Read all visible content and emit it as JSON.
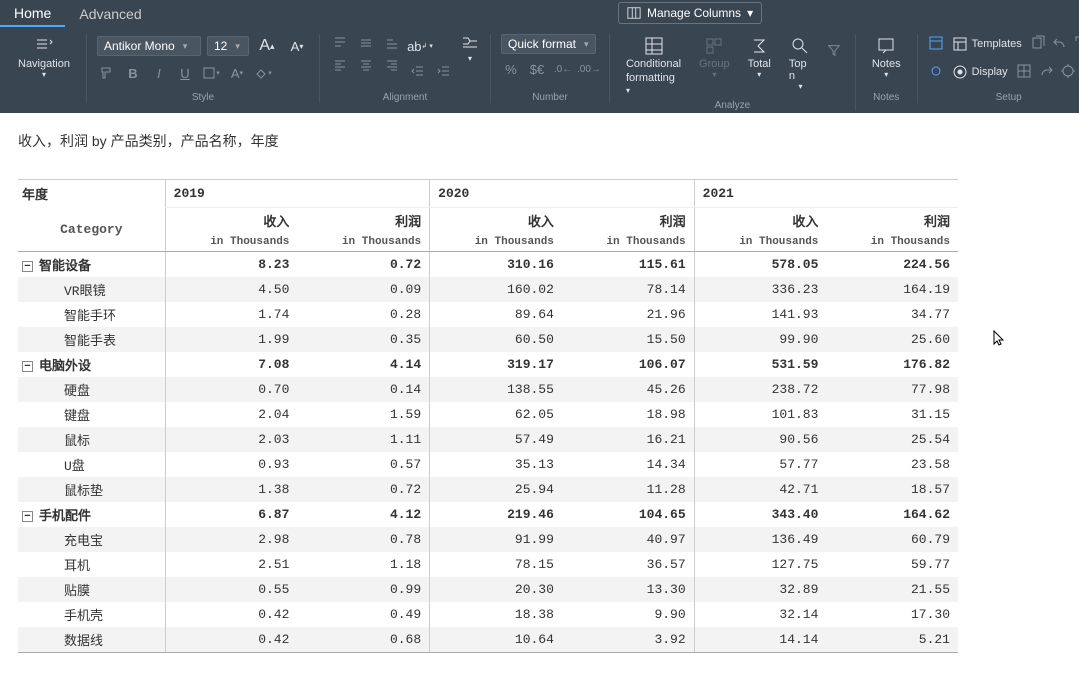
{
  "tabs": {
    "home": "Home",
    "advanced": "Advanced"
  },
  "manage_columns": "Manage Columns",
  "font_family": "Antikor Mono",
  "font_size": "12",
  "quick_format": "Quick format",
  "groups": {
    "style": "Style",
    "alignment": "Alignment",
    "number": "Number",
    "analyze": "Analyze",
    "notes": "Notes",
    "setup": "Setup"
  },
  "buttons": {
    "navigation": "Navigation",
    "conditional": "Conditional",
    "formatting": "formatting",
    "group": "Group",
    "total": "Total",
    "topn": "Top n",
    "notes": "Notes",
    "templates": "Templates",
    "display": "Display"
  },
  "title": "收入，利润 by 产品类别，产品名称，年度",
  "pivot": {
    "year_label": "年度",
    "category_label": "Category",
    "years": [
      "2019",
      "2020",
      "2021"
    ],
    "metrics": [
      "收入",
      "利润"
    ],
    "unit": "in Thousands",
    "rows": [
      {
        "type": "cat",
        "label": "智能设备",
        "v": [
          "8.23",
          "0.72",
          "310.16",
          "115.61",
          "578.05",
          "224.56"
        ]
      },
      {
        "type": "sub",
        "label": "VR眼镜",
        "v": [
          "4.50",
          "0.09",
          "160.02",
          "78.14",
          "336.23",
          "164.19"
        ]
      },
      {
        "type": "sub",
        "label": "智能手环",
        "v": [
          "1.74",
          "0.28",
          "89.64",
          "21.96",
          "141.93",
          "34.77"
        ]
      },
      {
        "type": "sub",
        "label": "智能手表",
        "v": [
          "1.99",
          "0.35",
          "60.50",
          "15.50",
          "99.90",
          "25.60"
        ]
      },
      {
        "type": "cat",
        "label": "电脑外设",
        "v": [
          "7.08",
          "4.14",
          "319.17",
          "106.07",
          "531.59",
          "176.82"
        ]
      },
      {
        "type": "sub",
        "label": "硬盘",
        "v": [
          "0.70",
          "0.14",
          "138.55",
          "45.26",
          "238.72",
          "77.98"
        ]
      },
      {
        "type": "sub",
        "label": "键盘",
        "v": [
          "2.04",
          "1.59",
          "62.05",
          "18.98",
          "101.83",
          "31.15"
        ]
      },
      {
        "type": "sub",
        "label": "鼠标",
        "v": [
          "2.03",
          "1.11",
          "57.49",
          "16.21",
          "90.56",
          "25.54"
        ]
      },
      {
        "type": "sub",
        "label": "U盘",
        "v": [
          "0.93",
          "0.57",
          "35.13",
          "14.34",
          "57.77",
          "23.58"
        ]
      },
      {
        "type": "sub",
        "label": "鼠标垫",
        "v": [
          "1.38",
          "0.72",
          "25.94",
          "11.28",
          "42.71",
          "18.57"
        ]
      },
      {
        "type": "cat",
        "label": "手机配件",
        "v": [
          "6.87",
          "4.12",
          "219.46",
          "104.65",
          "343.40",
          "164.62"
        ]
      },
      {
        "type": "sub",
        "label": "充电宝",
        "v": [
          "2.98",
          "0.78",
          "91.99",
          "40.97",
          "136.49",
          "60.79"
        ]
      },
      {
        "type": "sub",
        "label": "耳机",
        "v": [
          "2.51",
          "1.18",
          "78.15",
          "36.57",
          "127.75",
          "59.77"
        ]
      },
      {
        "type": "sub",
        "label": "贴膜",
        "v": [
          "0.55",
          "0.99",
          "20.30",
          "13.30",
          "32.89",
          "21.55"
        ]
      },
      {
        "type": "sub",
        "label": "手机壳",
        "v": [
          "0.42",
          "0.49",
          "18.38",
          "9.90",
          "32.14",
          "17.30"
        ]
      },
      {
        "type": "sub",
        "label": "数据线",
        "v": [
          "0.42",
          "0.68",
          "10.64",
          "3.92",
          "14.14",
          "5.21"
        ]
      }
    ]
  }
}
